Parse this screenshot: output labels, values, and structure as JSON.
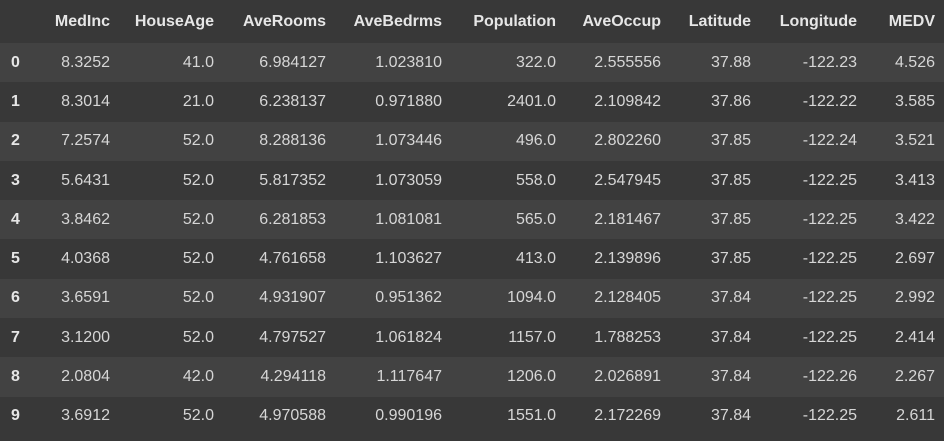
{
  "table": {
    "index_header": "",
    "columns": [
      "MedInc",
      "HouseAge",
      "AveRooms",
      "AveBedrms",
      "Population",
      "AveOccup",
      "Latitude",
      "Longitude",
      "MEDV"
    ],
    "rows": [
      {
        "index": "0",
        "cells": [
          "8.3252",
          "41.0",
          "6.984127",
          "1.023810",
          "322.0",
          "2.555556",
          "37.88",
          "-122.23",
          "4.526"
        ]
      },
      {
        "index": "1",
        "cells": [
          "8.3014",
          "21.0",
          "6.238137",
          "0.971880",
          "2401.0",
          "2.109842",
          "37.86",
          "-122.22",
          "3.585"
        ]
      },
      {
        "index": "2",
        "cells": [
          "7.2574",
          "52.0",
          "8.288136",
          "1.073446",
          "496.0",
          "2.802260",
          "37.85",
          "-122.24",
          "3.521"
        ]
      },
      {
        "index": "3",
        "cells": [
          "5.6431",
          "52.0",
          "5.817352",
          "1.073059",
          "558.0",
          "2.547945",
          "37.85",
          "-122.25",
          "3.413"
        ]
      },
      {
        "index": "4",
        "cells": [
          "3.8462",
          "52.0",
          "6.281853",
          "1.081081",
          "565.0",
          "2.181467",
          "37.85",
          "-122.25",
          "3.422"
        ]
      },
      {
        "index": "5",
        "cells": [
          "4.0368",
          "52.0",
          "4.761658",
          "1.103627",
          "413.0",
          "2.139896",
          "37.85",
          "-122.25",
          "2.697"
        ]
      },
      {
        "index": "6",
        "cells": [
          "3.6591",
          "52.0",
          "4.931907",
          "0.951362",
          "1094.0",
          "2.128405",
          "37.84",
          "-122.25",
          "2.992"
        ]
      },
      {
        "index": "7",
        "cells": [
          "3.1200",
          "52.0",
          "4.797527",
          "1.061824",
          "1157.0",
          "1.788253",
          "37.84",
          "-122.25",
          "2.414"
        ]
      },
      {
        "index": "8",
        "cells": [
          "2.0804",
          "42.0",
          "4.294118",
          "1.117647",
          "1206.0",
          "2.026891",
          "37.84",
          "-122.26",
          "2.267"
        ]
      },
      {
        "index": "9",
        "cells": [
          "3.6912",
          "52.0",
          "4.970588",
          "0.990196",
          "1551.0",
          "2.172269",
          "37.84",
          "-122.25",
          "2.611"
        ]
      }
    ]
  },
  "colors": {
    "background": "#383838",
    "stripe": "#424242",
    "text": "#d6d6d6",
    "header_text": "#e6e6e6"
  }
}
